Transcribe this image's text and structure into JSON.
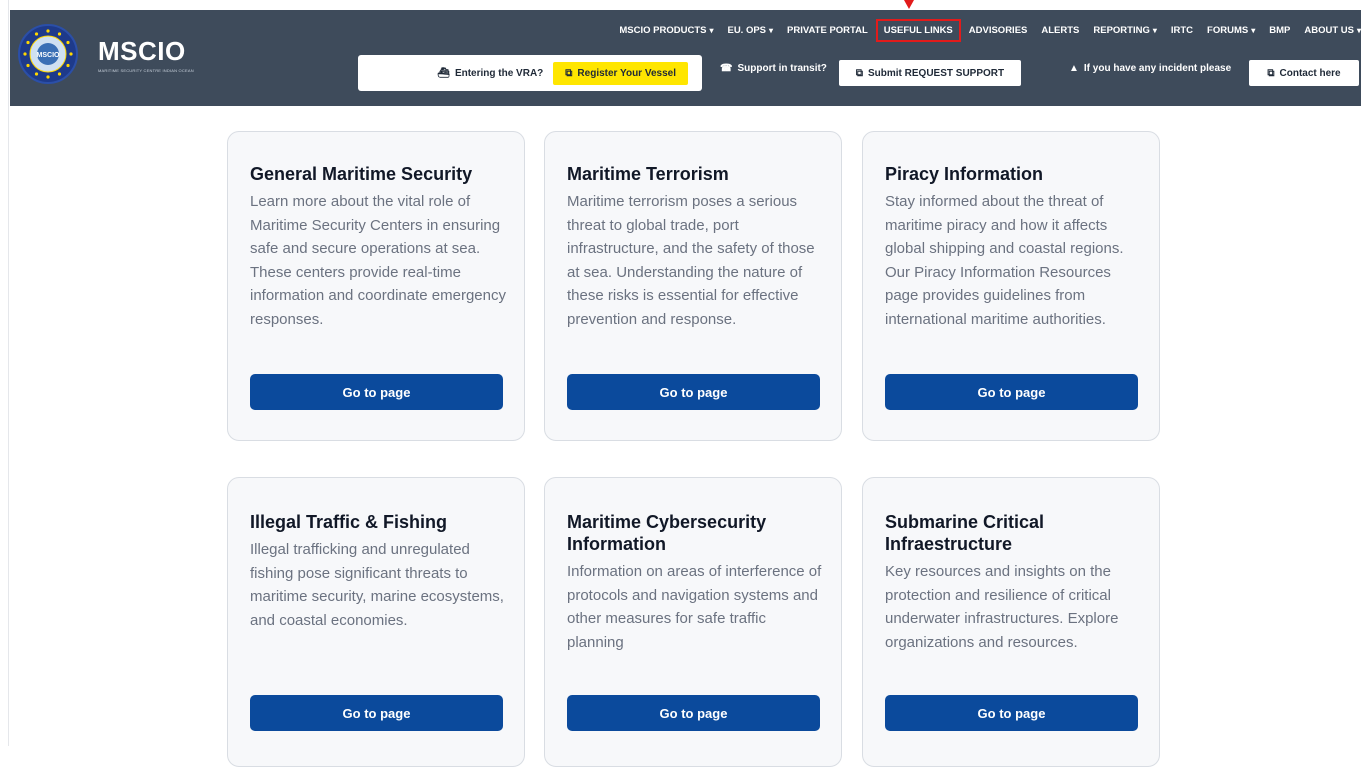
{
  "header": {
    "brand": "MSCIO",
    "brand_subtitle": "MARITIME SECURITY CENTRE INDIAN OCEAN",
    "logo_text": "MSCIO"
  },
  "nav": [
    {
      "label": "MSCIO PRODUCTS",
      "dropdown": true
    },
    {
      "label": "EU. OPS",
      "dropdown": true
    },
    {
      "label": "PRIVATE PORTAL",
      "dropdown": false
    },
    {
      "label": "USEFUL LINKS",
      "dropdown": false,
      "highlighted": true
    },
    {
      "label": "ADVISORIES",
      "dropdown": false
    },
    {
      "label": "ALERTS",
      "dropdown": false
    },
    {
      "label": "REPORTING",
      "dropdown": true
    },
    {
      "label": "IRTC",
      "dropdown": false
    },
    {
      "label": "FORUMS",
      "dropdown": true
    },
    {
      "label": "BMP",
      "dropdown": false
    },
    {
      "label": "ABOUT US",
      "dropdown": true
    }
  ],
  "actions": {
    "vra_label": "Entering the VRA?",
    "register_button": "Register Your Vessel",
    "support_label": "Support in transit?",
    "support_button": "Submit REQUEST SUPPORT",
    "incident_label": "If you have any incident please",
    "contact_button": "Contact here"
  },
  "icons": {
    "external": "⧉",
    "ship": "⛴",
    "headset": "☎",
    "warning": "▲",
    "caret": "▾"
  },
  "colors": {
    "header_bg": "#3e4b5b",
    "accent_yellow": "#ffe600",
    "button_blue": "#0b4a9c",
    "highlight_red": "#e21b1b"
  },
  "cards": [
    {
      "title": "General Maritime Security",
      "text": "Learn more about the vital role of Maritime Security Centers in ensuring safe and secure operations at sea. These centers provide real-time information and coordinate emergency responses.",
      "button": "Go to page"
    },
    {
      "title": "Maritime Terrorism",
      "text": "Maritime terrorism poses a serious threat to global trade, port infrastructure, and the safety of those at sea. Understanding the nature of these risks is essential for effective prevention and response.",
      "button": "Go to page"
    },
    {
      "title": "Piracy Information",
      "text": "Stay informed about the threat of maritime piracy and how it affects global shipping and coastal regions. Our Piracy Information Resources page provides guidelines from international maritime authorities.",
      "button": "Go to page"
    },
    {
      "title": "Illegal Traffic & Fishing",
      "text": "Illegal trafficking and unregulated fishing pose significant threats to maritime security, marine ecosystems, and coastal economies.",
      "button": "Go to page"
    },
    {
      "title": "Maritime Cybersecurity Information",
      "text": "Information on areas of interference of protocols and navigation systems and other measures for safe traffic planning",
      "button": "Go to page"
    },
    {
      "title": "Submarine Critical Infraestructure",
      "text": "Key resources and insights on the protection and resilience of critical underwater infrastructures. Explore organizations and resources.",
      "button": "Go to page"
    }
  ]
}
